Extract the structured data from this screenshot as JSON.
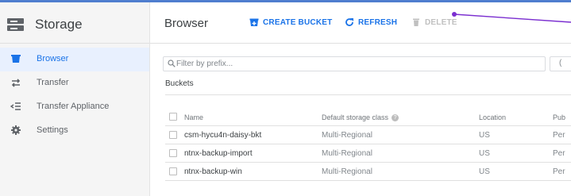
{
  "sidebar": {
    "title": "Storage",
    "items": [
      {
        "label": "Browser",
        "icon": "bucket-icon",
        "active": true
      },
      {
        "label": "Transfer",
        "icon": "swap-arrows-icon",
        "active": false
      },
      {
        "label": "Transfer Appliance",
        "icon": "list-arrow-icon",
        "active": false
      },
      {
        "label": "Settings",
        "icon": "gear-icon",
        "active": false
      }
    ]
  },
  "toolbar": {
    "title": "Browser",
    "create_bucket": "CREATE BUCKET",
    "refresh": "REFRESH",
    "delete": "DELETE"
  },
  "filter": {
    "placeholder": "Filter by prefix...",
    "value": ""
  },
  "section": {
    "label": "Buckets"
  },
  "table": {
    "headers": {
      "name": "Name",
      "storage_class": "Default storage class",
      "location": "Location",
      "public": "Pub"
    },
    "rows": [
      {
        "name": "csm-hycu4n-daisy-bkt",
        "storage_class": "Multi-Regional",
        "location": "US",
        "public": "Per"
      },
      {
        "name": "ntnx-backup-import",
        "storage_class": "Multi-Regional",
        "location": "US",
        "public": "Per"
      },
      {
        "name": "ntnx-backup-win",
        "storage_class": "Multi-Regional",
        "location": "US",
        "public": "Per"
      }
    ]
  },
  "colors": {
    "accent": "#1a73e8",
    "annotation": "#7b2fd0",
    "active_nav_bg": "#e8f0fe"
  }
}
